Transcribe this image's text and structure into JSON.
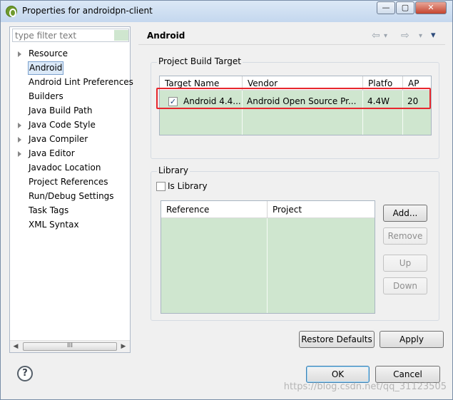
{
  "window": {
    "title": "Properties for androidpn-client",
    "minimize": "—",
    "maximize": "▢",
    "close": "✕"
  },
  "sidebar": {
    "filter_placeholder": "type filter text",
    "items": [
      {
        "label": "Resource",
        "expandable": true
      },
      {
        "label": "Android",
        "expandable": false,
        "selected": true
      },
      {
        "label": "Android Lint Preferences",
        "expandable": false
      },
      {
        "label": "Builders",
        "expandable": false
      },
      {
        "label": "Java Build Path",
        "expandable": false
      },
      {
        "label": "Java Code Style",
        "expandable": true
      },
      {
        "label": "Java Compiler",
        "expandable": true
      },
      {
        "label": "Java Editor",
        "expandable": true
      },
      {
        "label": "Javadoc Location",
        "expandable": false
      },
      {
        "label": "Project References",
        "expandable": false
      },
      {
        "label": "Run/Debug Settings",
        "expandable": false
      },
      {
        "label": "Task Tags",
        "expandable": false
      },
      {
        "label": "XML Syntax",
        "expandable": false
      }
    ],
    "scroll_grip": "III"
  },
  "main": {
    "title": "Android",
    "nav": {
      "back": "⇦",
      "forward": "⇨",
      "menu": "▾"
    },
    "build_target": {
      "group_label": "Project Build Target",
      "columns": [
        "Target Name",
        "Vendor",
        "Platfo",
        "AP"
      ],
      "rows": [
        {
          "checked": true,
          "check_mark": "✓",
          "target": "Android 4.4...",
          "vendor": "Android Open Source Pr...",
          "platform": "4.4W",
          "api": "20"
        }
      ]
    },
    "library": {
      "group_label": "Library",
      "is_library_label": "Is Library",
      "is_library_checked": false,
      "columns": [
        "Reference",
        "Project"
      ],
      "buttons": {
        "add": "Add...",
        "remove": "Remove",
        "up": "Up",
        "down": "Down"
      }
    },
    "restore_defaults": "Restore Defaults",
    "apply": "Apply"
  },
  "footer": {
    "help": "?",
    "ok": "OK",
    "cancel": "Cancel",
    "watermark": "https://blog.csdn.net/qq_31123505"
  },
  "colors": {
    "table_fill": "#cfe6cf",
    "highlight": "#e8262d",
    "selection": "#dbe9f8"
  }
}
